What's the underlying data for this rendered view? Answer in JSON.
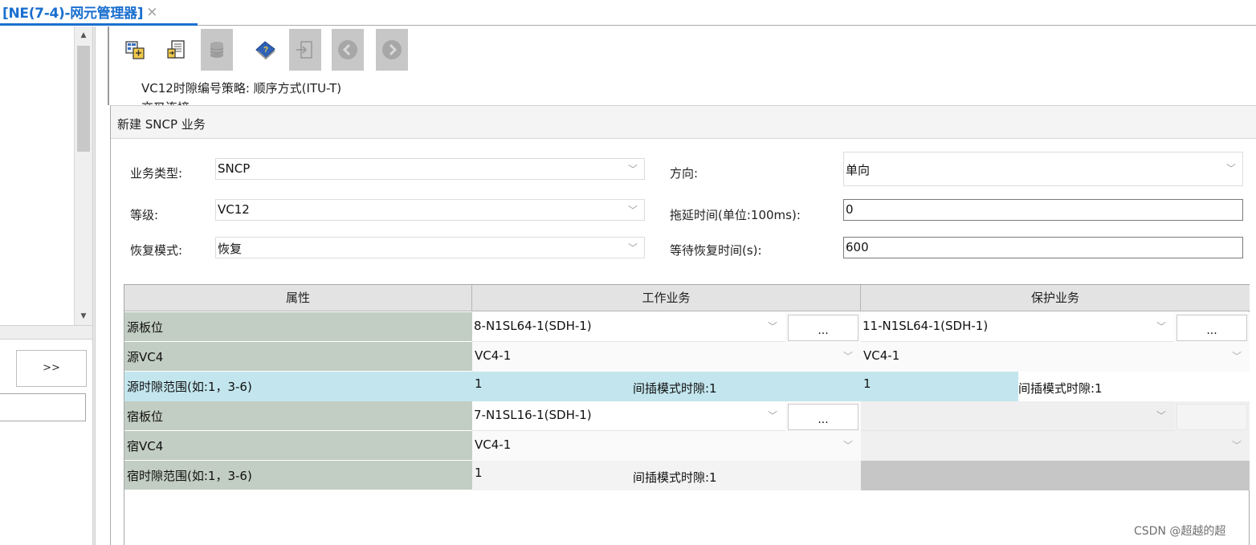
{
  "tab": {
    "title": "[NE(7-4)-网元管理器]",
    "close": "×"
  },
  "left": {
    "expand_label": ">>"
  },
  "toolbar": {
    "icons": [
      "config-icon",
      "export-icon",
      "database-icon",
      "help-book-icon",
      "login-icon",
      "back-icon",
      "forward-icon"
    ]
  },
  "info": {
    "line1": "VC12时隙编号策略: 顺序方式(ITU-T)",
    "line2": "交叉连接"
  },
  "dialog": {
    "title": "新建 SNCP 业务",
    "form": {
      "service_type_label": "业务类型:",
      "service_type_value": "SNCP",
      "direction_label": "方向:",
      "direction_value": "单向",
      "level_label": "等级:",
      "level_value": "VC12",
      "delay_label": "拖延时间(单位:100ms):",
      "delay_value": "0",
      "revert_mode_label": "恢复模式:",
      "revert_mode_value": "恢复",
      "wtr_label": "等待恢复时间(s):",
      "wtr_value": "600"
    },
    "table": {
      "headers": [
        "属性",
        "工作业务",
        "保护业务"
      ],
      "rows": [
        {
          "attr": "源板位",
          "work": "8-N1SL64-1(SDH-1)",
          "work_button": "...",
          "prot": "11-N1SL64-1(SDH-1)",
          "prot_button": "..."
        },
        {
          "attr": "源VC4",
          "work": "VC4-1",
          "prot": "VC4-1"
        },
        {
          "attr": "源时隙范围(如:1，3-6)",
          "work": "1",
          "work_extra": "间插模式时隙:1",
          "prot": "1",
          "prot_extra": "间插模式时隙:1"
        },
        {
          "attr": "宿板位",
          "work": "7-N1SL16-1(SDH-1)",
          "work_button": "...",
          "prot": "",
          "prot_button": ""
        },
        {
          "attr": "宿VC4",
          "work": "VC4-1",
          "prot": ""
        },
        {
          "attr": "宿时隙范围(如:1，3-6)",
          "work": "1",
          "work_extra": "间插模式时隙:1",
          "prot": ""
        }
      ]
    }
  },
  "watermark": "CSDN @超越的超",
  "colors": {
    "accent": "#1a6fcf",
    "attr_cell": "#c2cdc3",
    "timeslot_highlight": "#c3e6ee",
    "header": "#e3e3e3"
  }
}
